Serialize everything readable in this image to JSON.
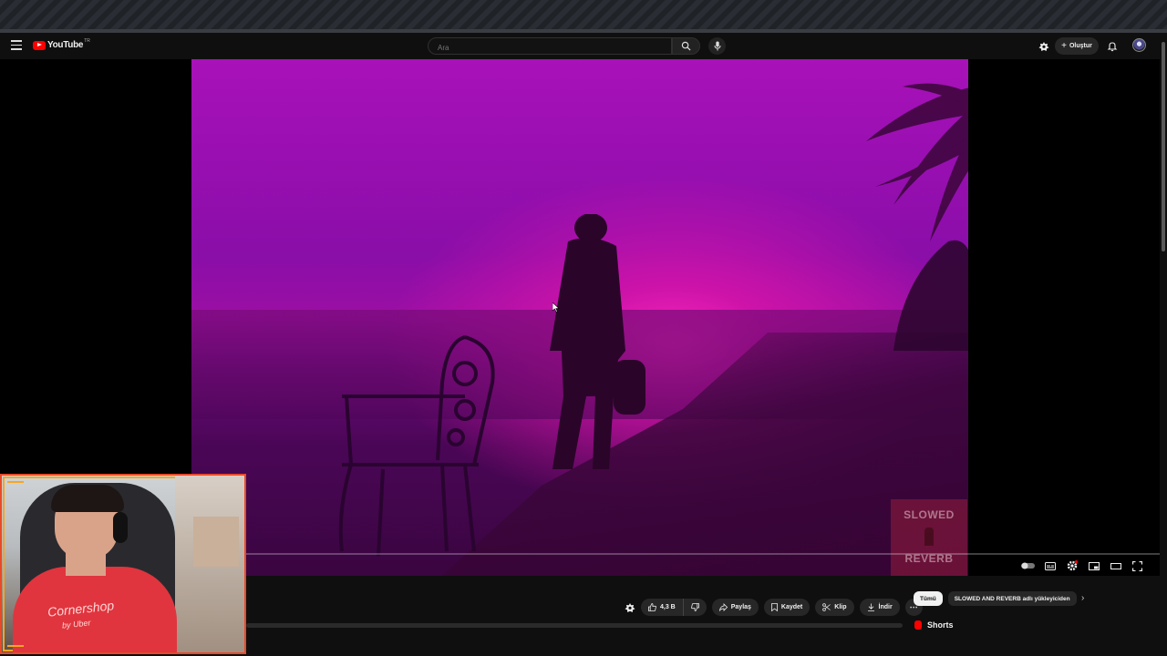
{
  "header": {
    "logo_text": "YouTube",
    "logo_region": "TR",
    "search_placeholder": "Ara",
    "create_label": "Oluştur"
  },
  "player": {
    "watermark_line1": "SLOWED",
    "watermark_line2": "REVERB",
    "progress_fraction": 0.0
  },
  "actions": {
    "like_count": "4,3 B",
    "share_label": "Paylaş",
    "save_label": "Kaydet",
    "clip_label": "Klip",
    "download_label": "İndir"
  },
  "chips": {
    "all_label": "Tümü",
    "uploader_label": "SLOWED AND REVERB adlı yükleyiciden"
  },
  "sidebar": {
    "shorts_label": "Shorts"
  },
  "webcam": {
    "shirt_text": "Cornershop",
    "shirt_subtext": "by Uber"
  },
  "icons": {
    "menu": "hamburger-icon",
    "search": "search-icon",
    "mic": "mic-icon",
    "notifications": "bell-icon"
  },
  "colors": {
    "brand_red": "#ff0000",
    "video_tint": "#9a0fb2",
    "webcam_border": "#e84a2a"
  }
}
